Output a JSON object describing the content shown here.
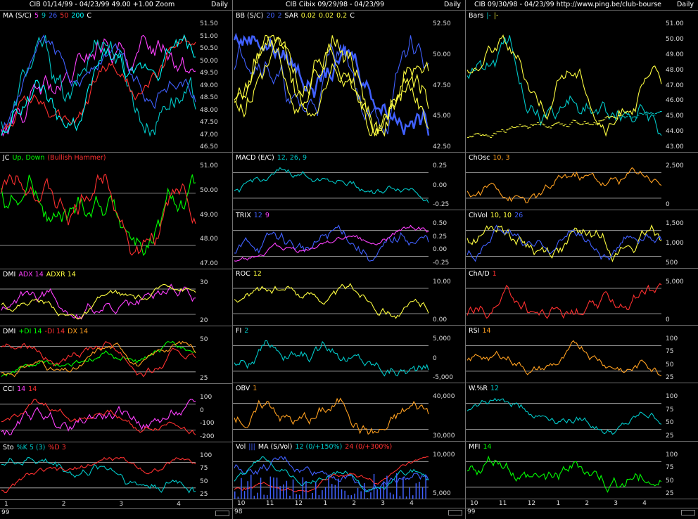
{
  "columns": [
    {
      "title": "CIB  01/14/99 - 04/23/99   49.00  +1.00   Zoom",
      "period": "Daily",
      "x_labels": [
        "1",
        "2",
        "3",
        "4"
      ],
      "year_label": "99",
      "panels": [
        {
          "id": "p11",
          "h": 202,
          "labels": [
            {
              "t": "MA (S/C)",
              "c": "#ffffff"
            },
            {
              "t": "5",
              "c": "#ff40ff"
            },
            {
              "t": "9",
              "c": "#00c8c8"
            },
            {
              "t": "26",
              "c": "#4060ff"
            },
            {
              "t": "50",
              "c": "#ff3030"
            },
            {
              "t": "200",
              "c": "#00ffff"
            },
            {
              "t": "C",
              "c": "#ffffff"
            }
          ],
          "y_ticks": [
            "51.50",
            "51.00",
            "50.50",
            "50.00",
            "49.50",
            "49.00",
            "48.50",
            "48.00",
            "47.50",
            "47.00",
            "46.50"
          ]
        },
        {
          "id": "p12",
          "h": 166,
          "labels": [
            {
              "t": "JC",
              "c": "#ffffff"
            },
            {
              "t": "Up, Down",
              "c": "#00ff00"
            },
            {
              "t": "(Bullish Hammer)",
              "c": "#ff3030"
            }
          ],
          "y_ticks": [
            "51.00",
            "50.00",
            "49.00",
            "48.00",
            "47.00"
          ]
        },
        {
          "id": "p13",
          "h": 81,
          "labels": [
            {
              "t": "DMI",
              "c": "#ffffff"
            },
            {
              "t": "ADX 14",
              "c": "#ff40ff"
            },
            {
              "t": "ADXR 14",
              "c": "#ffff40"
            }
          ],
          "y_ticks": [
            "30",
            "20"
          ]
        },
        {
          "id": "p14",
          "h": 82,
          "labels": [
            {
              "t": "DMI",
              "c": "#ffffff"
            },
            {
              "t": "+DI 14",
              "c": "#00ff00"
            },
            {
              "t": "-DI 14",
              "c": "#ff3030"
            },
            {
              "t": "DX 14",
              "c": "#ffa020"
            }
          ],
          "y_ticks": [
            "50",
            "25"
          ]
        },
        {
          "id": "p15",
          "h": 83,
          "labels": [
            {
              "t": "CCI",
              "c": "#ffffff"
            },
            {
              "t": "14",
              "c": "#ff40ff"
            },
            {
              "t": "14",
              "c": "#ff3030"
            }
          ],
          "y_ticks": [
            "100",
            "0",
            "-100",
            "-200"
          ]
        },
        {
          "id": "p16",
          "h": 82,
          "labels": [
            {
              "t": "Sto",
              "c": "#ffffff"
            },
            {
              "t": "%K 5 (3)",
              "c": "#00c8c8"
            },
            {
              "t": "%D 3",
              "c": "#ff3030"
            }
          ],
          "y_ticks": [
            "100",
            "75",
            "50",
            "25"
          ]
        }
      ]
    },
    {
      "title": "CIB  Cibix  09/29/98 - 04/23/99",
      "period": "Daily",
      "x_labels": [
        "10",
        "11",
        "12",
        "1",
        "2",
        "3",
        "4"
      ],
      "year_label": "98",
      "panels": [
        {
          "id": "p21",
          "h": 202,
          "labels": [
            {
              "t": "BB (S/C)",
              "c": "#ffffff"
            },
            {
              "t": "20",
              "c": "#4060ff"
            },
            {
              "t": "2",
              "c": "#4060ff"
            },
            {
              "t": "SAR",
              "c": "#ffffff"
            },
            {
              "t": "0.02",
              "c": "#ffff40"
            },
            {
              "t": "0.02",
              "c": "#ffff40"
            },
            {
              "t": "0.2",
              "c": "#ffff40"
            },
            {
              "t": "C",
              "c": "#ffffff"
            }
          ],
          "y_ticks": [
            "52.50",
            "50.00",
            "47.50",
            "45.00",
            "42.50"
          ]
        },
        {
          "id": "p22",
          "h": 82,
          "labels": [
            {
              "t": "MACD (E/C)",
              "c": "#ffffff"
            },
            {
              "t": "12, 26, 9",
              "c": "#00c8c8"
            }
          ],
          "y_ticks": [
            "0.25",
            "0.00",
            "-0.25"
          ]
        },
        {
          "id": "p23",
          "h": 83,
          "labels": [
            {
              "t": "TRIX",
              "c": "#ffffff"
            },
            {
              "t": "12",
              "c": "#4060ff"
            },
            {
              "t": "9",
              "c": "#ff40ff"
            }
          ],
          "y_ticks": [
            "0.50",
            "0.25",
            "0.00",
            "-0.25"
          ]
        },
        {
          "id": "p24",
          "h": 81,
          "labels": [
            {
              "t": "ROC",
              "c": "#ffffff"
            },
            {
              "t": "12",
              "c": "#ffff40"
            }
          ],
          "y_ticks": [
            "10.00",
            "0.00"
          ]
        },
        {
          "id": "p25",
          "h": 82,
          "labels": [
            {
              "t": "FI",
              "c": "#ffffff"
            },
            {
              "t": "2",
              "c": "#00c8c8"
            }
          ],
          "y_ticks": [
            "5,000",
            "0",
            "-5,000"
          ]
        },
        {
          "id": "p26",
          "h": 83,
          "labels": [
            {
              "t": "OBV",
              "c": "#ffffff"
            },
            {
              "t": "1",
              "c": "#ffa020"
            }
          ],
          "y_ticks": [
            "40,000",
            "30,000"
          ]
        },
        {
          "id": "p27",
          "h": 82,
          "labels": [
            {
              "t": "Vol",
              "c": "#ffffff"
            },
            {
              "t": "|||",
              "c": "#4060ff"
            },
            {
              "t": "MA (S/Vol)",
              "c": "#ffffff"
            },
            {
              "t": "12 (0/+150%)",
              "c": "#00c8c8"
            },
            {
              "t": "24 (0/+300%)",
              "c": "#ff3030"
            }
          ],
          "y_ticks": [
            "10,000",
            "5,000"
          ]
        }
      ]
    },
    {
      "title": "CIB  09/30/98 - 04/23/99     http://www.ping.be/club-bourse",
      "period": "Daily",
      "x_labels": [
        "10",
        "11",
        "12",
        "1",
        "2",
        "3",
        "4"
      ],
      "year_label": "99",
      "panels": [
        {
          "id": "p31",
          "h": 202,
          "labels": [
            {
              "t": "Bars",
              "c": "#ffffff"
            },
            {
              "t": "|-",
              "c": "#00c8c8"
            },
            {
              "t": "|-",
              "c": "#ffff40"
            }
          ],
          "y_ticks": [
            "51.00",
            "50.00",
            "49.00",
            "48.00",
            "47.00",
            "46.00",
            "45.00",
            "44.00",
            "43.00"
          ]
        },
        {
          "id": "p32",
          "h": 82,
          "labels": [
            {
              "t": "ChOsc",
              "c": "#ffffff"
            },
            {
              "t": "10, 3",
              "c": "#ffa020"
            }
          ],
          "y_ticks": [
            "2,500",
            "0"
          ]
        },
        {
          "id": "p33",
          "h": 83,
          "labels": [
            {
              "t": "ChVol",
              "c": "#ffffff"
            },
            {
              "t": "10, 10",
              "c": "#ffff40"
            },
            {
              "t": "26",
              "c": "#4060ff"
            }
          ],
          "y_ticks": [
            "1,500",
            "1,000",
            "500"
          ]
        },
        {
          "id": "p34",
          "h": 81,
          "labels": [
            {
              "t": "ChA/D",
              "c": "#ffffff"
            },
            {
              "t": "1",
              "c": "#ff3030"
            }
          ],
          "y_ticks": [
            "5,000",
            "0"
          ]
        },
        {
          "id": "p35",
          "h": 82,
          "labels": [
            {
              "t": "RSI",
              "c": "#ffffff"
            },
            {
              "t": "14",
              "c": "#ffa020"
            }
          ],
          "y_ticks": [
            "100",
            "75",
            "50",
            "25"
          ]
        },
        {
          "id": "p36",
          "h": 83,
          "labels": [
            {
              "t": "W.%R",
              "c": "#ffffff"
            },
            {
              "t": "12",
              "c": "#00c8c8"
            }
          ],
          "y_ticks": [
            "100",
            "75",
            "50",
            "25"
          ]
        },
        {
          "id": "p37",
          "h": 82,
          "labels": [
            {
              "t": "MFI",
              "c": "#ffffff"
            },
            {
              "t": "14",
              "c": "#00ff00"
            }
          ],
          "y_ticks": [
            "100",
            "75",
            "50",
            "25"
          ]
        }
      ]
    }
  ],
  "chart_data": [
    {
      "type": "line",
      "title": "MA (S/C)",
      "series": [
        {
          "name": "C",
          "color": "#ffa020"
        },
        {
          "name": "5",
          "color": "#ff40ff"
        },
        {
          "name": "9",
          "color": "#00c8c8"
        },
        {
          "name": "26",
          "color": "#4060ff"
        },
        {
          "name": "50",
          "color": "#ff3030"
        }
      ],
      "ylim": [
        46,
        52
      ]
    },
    {
      "type": "line",
      "title": "BB (S/C)",
      "series": [
        {
          "name": "20",
          "color": "#4060ff"
        },
        {
          "name": "SAR",
          "color": "#ffff40"
        },
        {
          "name": "C",
          "color": "#ffa020"
        }
      ],
      "ylim": [
        40,
        54
      ]
    },
    {
      "type": "bar",
      "title": "Bars",
      "ylim": [
        42,
        52
      ]
    },
    {
      "type": "line",
      "title": "Sto",
      "series": [
        {
          "name": "%K 5 (3)",
          "color": "#00c8c8"
        },
        {
          "name": "%D 3",
          "color": "#ff3030"
        }
      ],
      "ylim": [
        0,
        100
      ]
    }
  ]
}
